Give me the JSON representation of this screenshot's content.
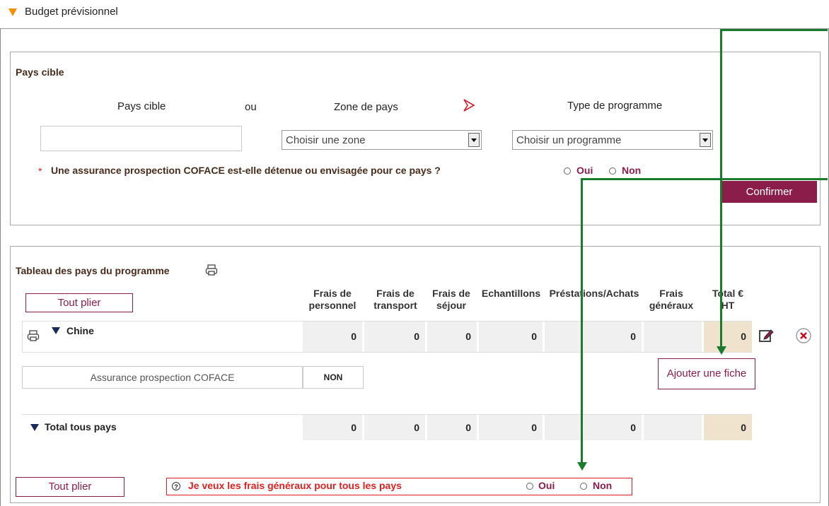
{
  "header": {
    "title": "Budget prévisionnel"
  },
  "pays_cible": {
    "section_title": "Pays cible",
    "col_pays": "Pays cible",
    "ou": "ou",
    "col_zone": "Zone de pays",
    "col_type": "Type de programme",
    "pays_input_value": "",
    "zone_selected": "Choisir une zone",
    "programme_selected": "Choisir un programme",
    "required_mark": "*",
    "question": "Une assurance prospection COFACE est-elle détenue ou envisagée pour ce pays ?",
    "oui": "Oui",
    "non": "Non",
    "confirm": "Confirmer"
  },
  "tableau": {
    "title": "Tableau des pays du programme",
    "tout_plier": "Tout plier",
    "columns": [
      [
        "Frais de",
        "personnel"
      ],
      [
        "Frais de",
        "transport"
      ],
      [
        "Frais de",
        "séjour"
      ],
      [
        "Echantillons",
        ""
      ],
      [
        "Préstations/Achats",
        ""
      ],
      [
        "Frais",
        "généraux"
      ],
      [
        "Total €",
        "HT"
      ]
    ],
    "rows": [
      {
        "name": "Chine",
        "values": [
          "0",
          "0",
          "0",
          "0",
          "0",
          "",
          "0"
        ]
      }
    ],
    "assurance_label": "Assurance prospection COFACE",
    "assurance_value": "NON",
    "ajouter_fiche": "Ajouter une fiche",
    "total_label": "Total tous pays",
    "total_values": [
      "0",
      "0",
      "0",
      "0",
      "0",
      "",
      "0"
    ]
  },
  "footer": {
    "tout_plier": "Tout plier",
    "help_glyph": "?",
    "question": "Je veux les frais généraux pour tous les pays",
    "oui": "Oui",
    "non": "Non"
  },
  "colors": {
    "accent": "#8b1d4a",
    "arrow": "#1a7a2e",
    "header_triangle": "#f39100",
    "error": "#e02020"
  }
}
